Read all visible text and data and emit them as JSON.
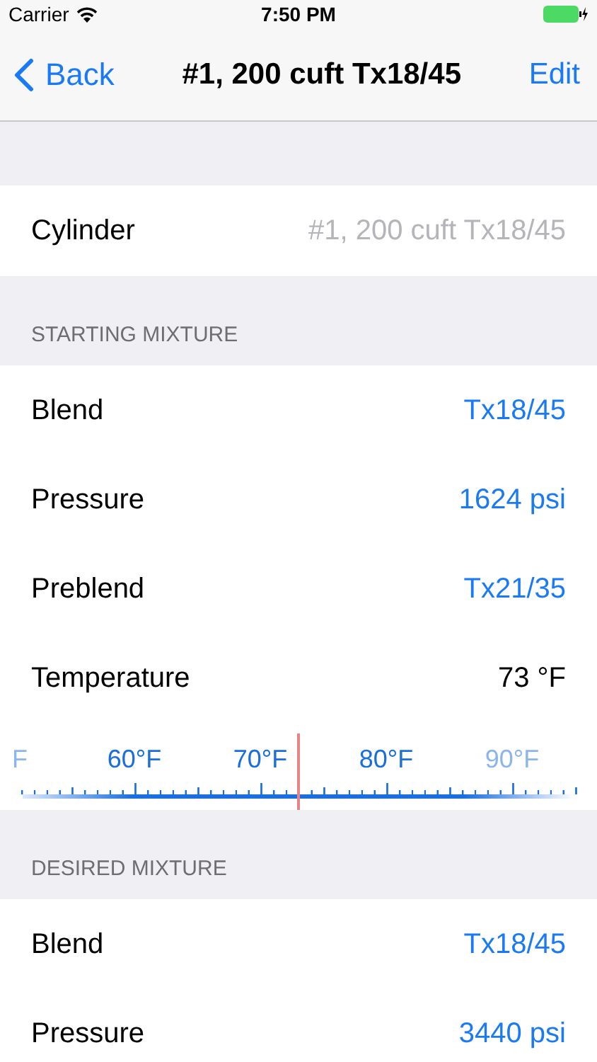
{
  "status_bar": {
    "carrier": "Carrier",
    "time": "7:50 PM"
  },
  "nav": {
    "back": "Back",
    "title": "#1, 200 cuft Tx18/45",
    "action": "Edit"
  },
  "cylinder": {
    "label": "Cylinder",
    "value": "#1, 200 cuft Tx18/45"
  },
  "sections": [
    {
      "header": "STARTING MIXTURE",
      "rows": [
        {
          "label": "Blend",
          "value": "Tx18/45",
          "kind": "link"
        },
        {
          "label": "Pressure",
          "value": "1624 psi",
          "kind": "link"
        },
        {
          "label": "Preblend",
          "value": "Tx21/35",
          "kind": "link"
        },
        {
          "label": "Temperature",
          "value": "73 °F",
          "kind": "plain"
        }
      ],
      "ruler": {
        "labels": [
          {
            "text": "F",
            "faded": true
          },
          {
            "text": "60°F",
            "faded": false
          },
          {
            "text": "70°F",
            "faded": false
          },
          {
            "text": "80°F",
            "faded": false
          },
          {
            "text": "90°F",
            "faded": true
          }
        ]
      }
    },
    {
      "header": "DESIRED MIXTURE",
      "rows": [
        {
          "label": "Blend",
          "value": "Tx18/45",
          "kind": "link"
        },
        {
          "label": "Pressure",
          "value": "3440 psi",
          "kind": "link"
        }
      ]
    }
  ]
}
